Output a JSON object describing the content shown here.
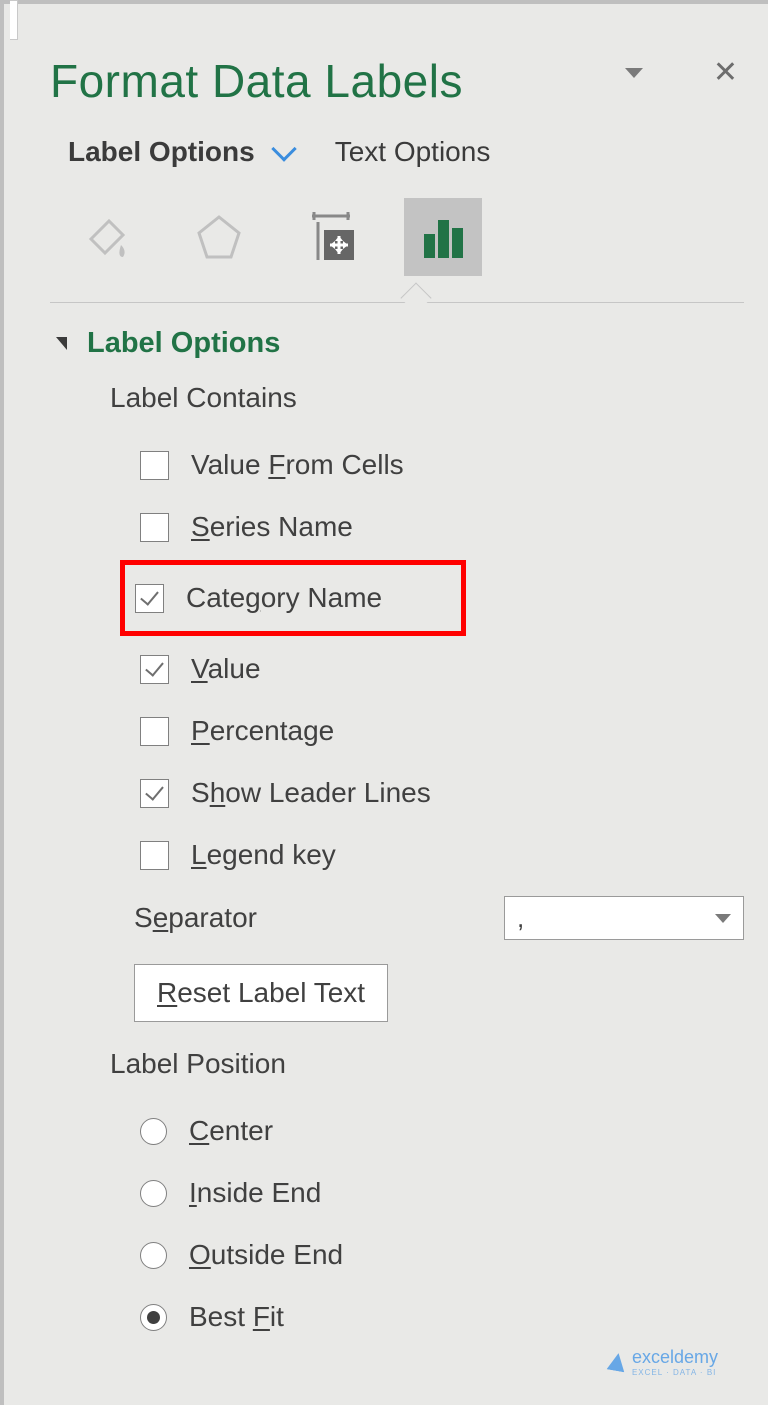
{
  "title": "Format Data Labels",
  "tabs": {
    "label_options": "Label Options",
    "text_options": "Text Options"
  },
  "icons": {
    "fill": "paint-bucket",
    "effects": "pentagon",
    "size": "size-props",
    "label": "bar-chart"
  },
  "section": {
    "heading": "Label Options",
    "label_contains": "Label Contains",
    "checks": {
      "value_from_cells": {
        "label_pre": "Value ",
        "u": "F",
        "label_post": "rom Cells",
        "checked": false
      },
      "series_name": {
        "u": "S",
        "label_post": "eries Name",
        "checked": false
      },
      "category_name": {
        "label_pre": "Cate",
        "u": "g",
        "label_post": "ory Name",
        "checked": true
      },
      "value": {
        "u": "V",
        "label_post": "alue",
        "checked": true
      },
      "percentage": {
        "u": "P",
        "label_post": "ercentage",
        "checked": false
      },
      "show_leader": {
        "label_pre": "S",
        "u": "h",
        "label_post": "ow Leader Lines",
        "checked": true
      },
      "legend_key": {
        "u": "L",
        "label_post": "egend key",
        "checked": false
      }
    },
    "separator_label_pre": "S",
    "separator_u": "e",
    "separator_label_post": "parator",
    "separator_value": ",",
    "reset_pre": "",
    "reset_u": "R",
    "reset_post": "eset Label Text",
    "label_position": "Label Position",
    "radios": {
      "center": {
        "u": "C",
        "label_post": "enter",
        "checked": false
      },
      "inside_end": {
        "u": "I",
        "label_post": "nside End",
        "checked": false
      },
      "outside_end": {
        "u": "O",
        "label_post": "utside End",
        "checked": false
      },
      "best_fit": {
        "label_pre": "Best ",
        "u": "F",
        "label_post": "it",
        "checked": true
      }
    }
  },
  "watermark": {
    "brand": "exceldemy",
    "sub": "EXCEL · DATA · BI"
  }
}
